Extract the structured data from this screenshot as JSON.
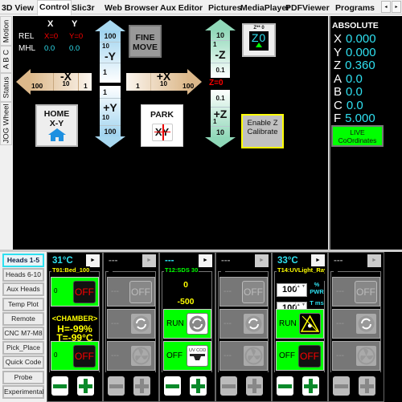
{
  "tabs": {
    "items": [
      "3D View",
      "Control",
      "Slic3r",
      "Web Browser",
      "Aux Editor",
      "Pictures",
      "MediaPlayer",
      "PDFViewer",
      "Programs"
    ],
    "active": "Control",
    "scroll_left": "◂",
    "scroll_right": "▸"
  },
  "side_tabs": [
    "Motion",
    "A B C",
    "Status",
    "JOG Wheel"
  ],
  "motion": {
    "col_x": "X",
    "col_y": "Y",
    "rel_label": "REL",
    "rel_x": "X=0",
    "rel_y": "Y=0",
    "mhl_label": "MHL",
    "mhl_x": "0.0",
    "mhl_y": "0.0",
    "minus_y": {
      "label": "-Y",
      "steps": [
        "100",
        "10",
        "1"
      ]
    },
    "plus_y": {
      "label": "+Y",
      "steps": [
        "1",
        "10",
        "100"
      ]
    },
    "minus_x": {
      "label": "-X",
      "steps": [
        "100",
        "10",
        "1"
      ]
    },
    "plus_x": {
      "label": "+X",
      "steps": [
        "1",
        "10",
        "100"
      ]
    },
    "minus_z": {
      "label": "-Z",
      "steps": [
        "10",
        "1",
        "0.1"
      ]
    },
    "plus_z": {
      "label": "+Z",
      "steps": [
        "0.1",
        "1",
        "10"
      ]
    },
    "z_zero": "Z=0",
    "fine_move": "FINE MOVE",
    "home": "HOME X-Y",
    "park": "PARK",
    "park_icon_text": "XY",
    "z0_button_top": "Z** 0",
    "z0_button_text": "Z0",
    "enable_z": "Enable Z Calibrate"
  },
  "absolute": {
    "title": "ABSOLUTE",
    "rows": [
      {
        "axis": "X",
        "value": "0.000"
      },
      {
        "axis": "Y",
        "value": "0.000"
      },
      {
        "axis": "Z",
        "value": "0.360"
      },
      {
        "axis": "A",
        "value": "0.0"
      },
      {
        "axis": "B",
        "value": "0.0"
      },
      {
        "axis": "C",
        "value": "0.0"
      },
      {
        "axis": "F",
        "value": "5.000"
      }
    ],
    "live_button": "LIVE CoOrdinates"
  },
  "left_buttons": [
    "Heads 1-5",
    "Heads 6-10",
    "Aux Heads",
    "Temp Plot",
    "Remote",
    "CNC M7-M8",
    "Pick_Place",
    "Quick Code",
    "Probe",
    "Experimental"
  ],
  "left_active": "Heads 1-5",
  "colors": {
    "accent_green": "#00ff00",
    "cyan": "#2fe0f0",
    "yellow": "#ffff00",
    "red": "#ff0000"
  },
  "heads": [
    {
      "active": true,
      "temp": "31°C",
      "label": "T91:Bed_100",
      "label_color": "#ffff00",
      "rows": [
        {
          "type": "green",
          "text": "0",
          "icon": "off-button",
          "icon_text": "OFF"
        },
        {
          "type": "chamber",
          "lines": [
            "<CHAMBER>",
            "H=-99%",
            "T=-99°C"
          ]
        },
        {
          "type": "green",
          "text": "0",
          "icon": "off-button",
          "icon_text": "OFF"
        }
      ]
    },
    {
      "active": false,
      "temp": "---",
      "label": "",
      "rows": [
        {
          "type": "gray",
          "text": "---",
          "icon": "off-button",
          "icon_text": "OFF"
        },
        {
          "type": "gray",
          "text": "---",
          "icon": "rotate-icon"
        },
        {
          "type": "gray",
          "text": "---",
          "icon": "fan-icon"
        }
      ]
    },
    {
      "active": true,
      "temp": "---",
      "label": "T12:SDS 30",
      "label_color": "#00ff00",
      "rows": [
        {
          "type": "values",
          "lines": [
            "0",
            "-500"
          ]
        },
        {
          "type": "green",
          "text": "RUN",
          "icon": "rotate-icon"
        },
        {
          "type": "green",
          "text": "OFF",
          "icon": "uv-cod-icon",
          "icon_text": "UV COD"
        }
      ]
    },
    {
      "active": false,
      "temp": "---",
      "label": "",
      "rows": [
        {
          "type": "gray",
          "text": "---",
          "icon": "off-button",
          "icon_text": "OFF"
        },
        {
          "type": "gray",
          "text": "---",
          "icon": "rotate-icon"
        },
        {
          "type": "gray",
          "text": "---",
          "icon": "fan-icon"
        }
      ]
    },
    {
      "active": true,
      "temp": "33°C",
      "label": "T14:UVLight_Ray",
      "label_color": "#ffff00",
      "rows": [
        {
          "type": "spin",
          "spins": [
            {
              "value": "100",
              "unit": "% PWR"
            },
            {
              "value": "100",
              "unit": "T ms"
            }
          ]
        },
        {
          "type": "green",
          "text": "RUN",
          "icon": "laser-warning-icon"
        },
        {
          "type": "green",
          "text": "OFF",
          "icon": "off-button",
          "icon_text": "OFF"
        }
      ]
    },
    {
      "active": false,
      "temp": "---",
      "label": "",
      "rows": [
        {
          "type": "gray",
          "text": "---",
          "icon": "off-button",
          "icon_text": "OFF"
        },
        {
          "type": "gray",
          "text": "---",
          "icon": "rotate-icon"
        },
        {
          "type": "gray",
          "text": "---",
          "icon": "fan-icon"
        }
      ]
    }
  ]
}
